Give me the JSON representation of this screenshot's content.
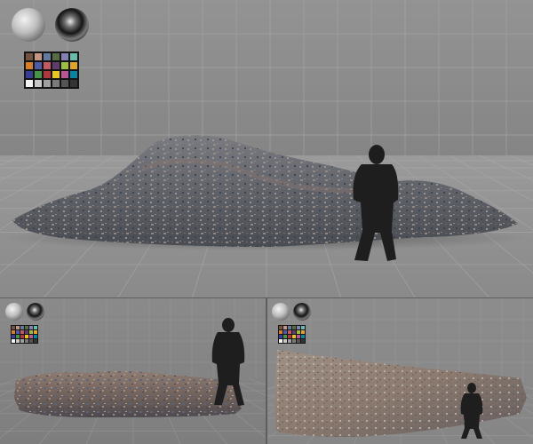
{
  "scene": {
    "panels": [
      {
        "view": "main",
        "subject": "rubble-pile"
      },
      {
        "view": "bottom-left",
        "subject": "rock-slab"
      },
      {
        "view": "bottom-right",
        "subject": "rock-slab"
      }
    ],
    "references": [
      "matte-grey-sphere",
      "chrome-sphere",
      "color-checker-card",
      "human-silhouette"
    ]
  },
  "colors": {
    "backdrop_wall": "#8a8a8a",
    "backdrop_floor": "#979797",
    "tile_line": "#a8a8a8",
    "silhouette": "#1e1e1e",
    "rubble_dark": "#4a4d55",
    "rubble_mid": "#6c6e76",
    "rubble_warm": "#7a6a63",
    "rock_warm": "#8f7d70",
    "rock_light": "#a4968a"
  },
  "color_checker": [
    "#735244",
    "#c29682",
    "#627a9d",
    "#576c43",
    "#8580b1",
    "#67bdaa",
    "#d67e2c",
    "#505ba6",
    "#c15a63",
    "#5e3c6c",
    "#9dbc40",
    "#e0a32e",
    "#383d96",
    "#469449",
    "#af363c",
    "#e7c71f",
    "#bb5695",
    "#0885a1",
    "#f3f3f2",
    "#c8c8c8",
    "#a0a0a0",
    "#7a7a79",
    "#555555",
    "#343434"
  ]
}
